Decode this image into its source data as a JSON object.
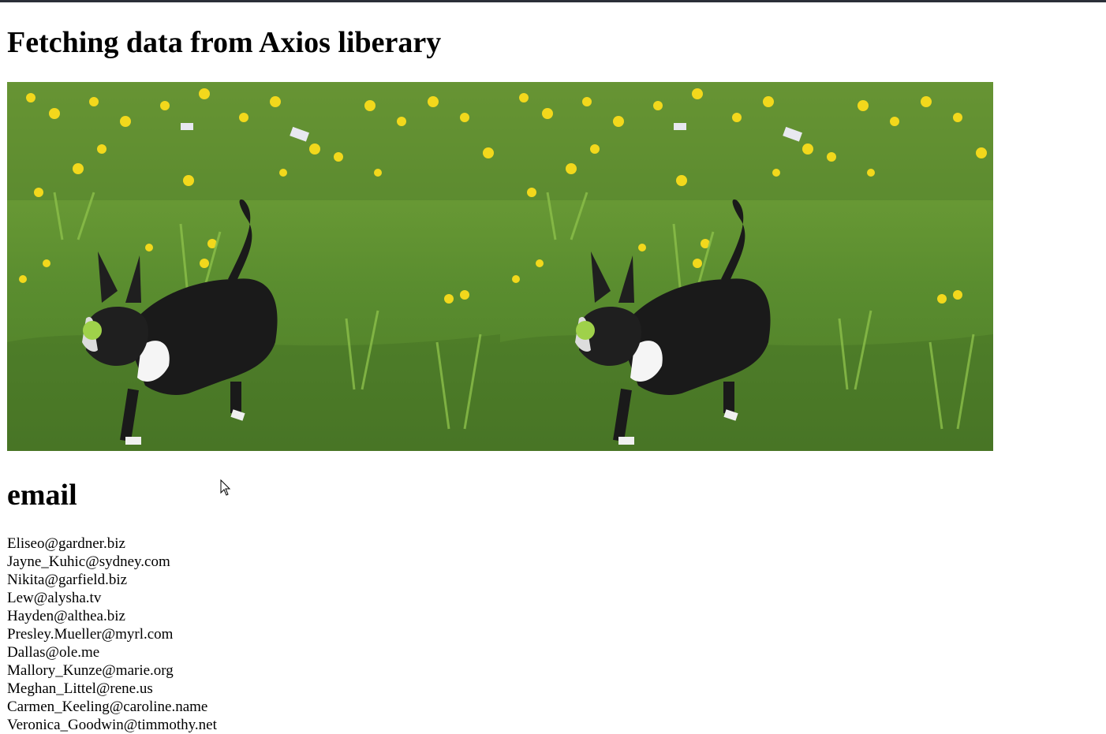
{
  "page": {
    "title": "Fetching data from Axios liberary"
  },
  "images": [
    {
      "alt": "dog-in-daffodil-field"
    },
    {
      "alt": "dog-in-daffodil-field"
    }
  ],
  "email_section": {
    "heading": "email",
    "emails": [
      "Eliseo@gardner.biz",
      "Jayne_Kuhic@sydney.com",
      "Nikita@garfield.biz",
      "Lew@alysha.tv",
      "Hayden@althea.biz",
      "Presley.Mueller@myrl.com",
      "Dallas@ole.me",
      "Mallory_Kunze@marie.org",
      "Meghan_Littel@rene.us",
      "Carmen_Keeling@caroline.name",
      "Veronica_Goodwin@timmothy.net"
    ]
  },
  "colors": {
    "top_border": "#2b2f38",
    "grass": "#5f8f33",
    "flower": "#f2d81c"
  }
}
